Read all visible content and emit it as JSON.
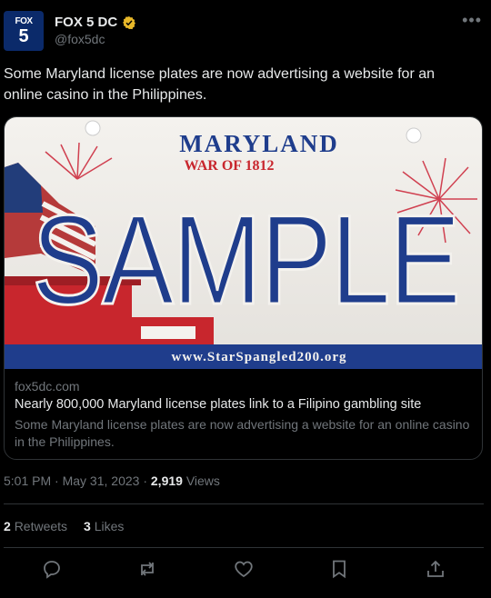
{
  "account": {
    "avatar_line1": "FOX",
    "avatar_line2": "5",
    "display_name": "FOX 5 DC",
    "handle": "@fox5dc",
    "more_icon": "ellipsis-icon"
  },
  "tweet": {
    "text": "Some Maryland license plates are now advertising a website for an online casino in the Philippines."
  },
  "card": {
    "plate": {
      "state": "MARYLAND",
      "subtitle": "WAR OF 1812",
      "plate_text": "SAMPLE",
      "website": "www.StarSpangled200.org"
    },
    "domain": "fox5dc.com",
    "title": "Nearly 800,000 Maryland license plates link to a Filipino gambling site",
    "description": "Some Maryland license plates are now advertising a website for an online casino in the Philippines."
  },
  "meta": {
    "time": "5:01 PM",
    "separator": "·",
    "date": "May 31, 2023",
    "views_count": "2,919",
    "views_label": "Views"
  },
  "stats": {
    "retweets_count": "2",
    "retweets_label": "Retweets",
    "likes_count": "3",
    "likes_label": "Likes"
  },
  "colors": {
    "background": "#000000",
    "text": "#e7e9ea",
    "muted": "#71767b",
    "border": "#2f3336",
    "verified_gold": "#e8b829",
    "avatar_blue": "#0b2a6a",
    "plate_blue": "#1f3d8c",
    "plate_red": "#c8262d"
  },
  "actions": [
    "reply-icon",
    "retweet-icon",
    "like-icon",
    "bookmark-icon",
    "share-icon"
  ]
}
